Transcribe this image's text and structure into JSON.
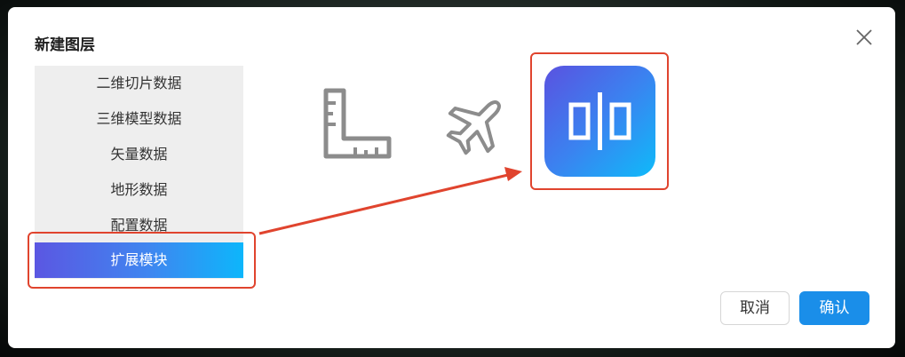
{
  "dialog": {
    "title": "新建图层",
    "close_icon": "close-icon"
  },
  "sidebar": {
    "items": [
      {
        "label": "二维切片数据",
        "active": false
      },
      {
        "label": "三维模型数据",
        "active": false
      },
      {
        "label": "矢量数据",
        "active": false
      },
      {
        "label": "地形数据",
        "active": false
      },
      {
        "label": "配置数据",
        "active": false
      },
      {
        "label": "扩展模块",
        "active": true
      }
    ],
    "active_gradient": [
      "#5b57e2",
      "#0db6fb"
    ]
  },
  "tiles": [
    {
      "icon": "ruler-icon",
      "color": "#8c8c8c"
    },
    {
      "icon": "airplane-icon",
      "color": "#8c8c8c"
    },
    {
      "icon": "split-panel-icon",
      "selected": true
    }
  ],
  "annotation": {
    "color": "#e0442e"
  },
  "footer": {
    "cancel_label": "取消",
    "ok_label": "确认",
    "ok_color": "#1a8ee9"
  }
}
